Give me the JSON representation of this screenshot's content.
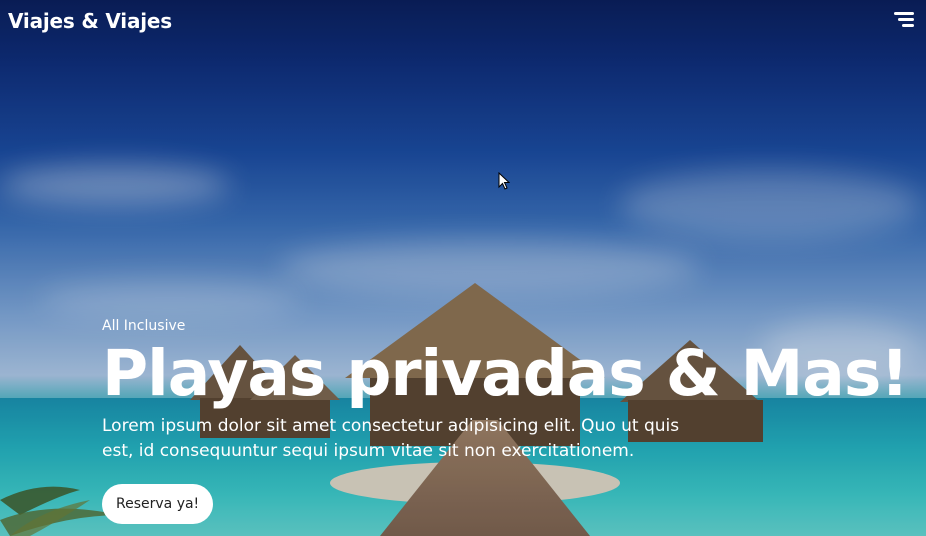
{
  "nav": {
    "brand": "Viajes & Viajes",
    "menu_icon": "hamburger-menu-icon"
  },
  "hero": {
    "kicker": "All Inclusive",
    "headline": "Playas privadas & Mas!",
    "description": "Lorem ipsum dolor sit amet consectetur adipisicing elit. Quo ut quis est, id consequuntur sequi ipsum vitae sit non exercitationem.",
    "cta_label": "Reserva ya!",
    "background_image": "overwater-bungalows-beach-photo"
  },
  "colors": {
    "text": "#ffffff",
    "button_bg": "#ffffff",
    "button_text": "#222222",
    "sky_top": "#0a1f5c",
    "sea": "#23aebd"
  }
}
